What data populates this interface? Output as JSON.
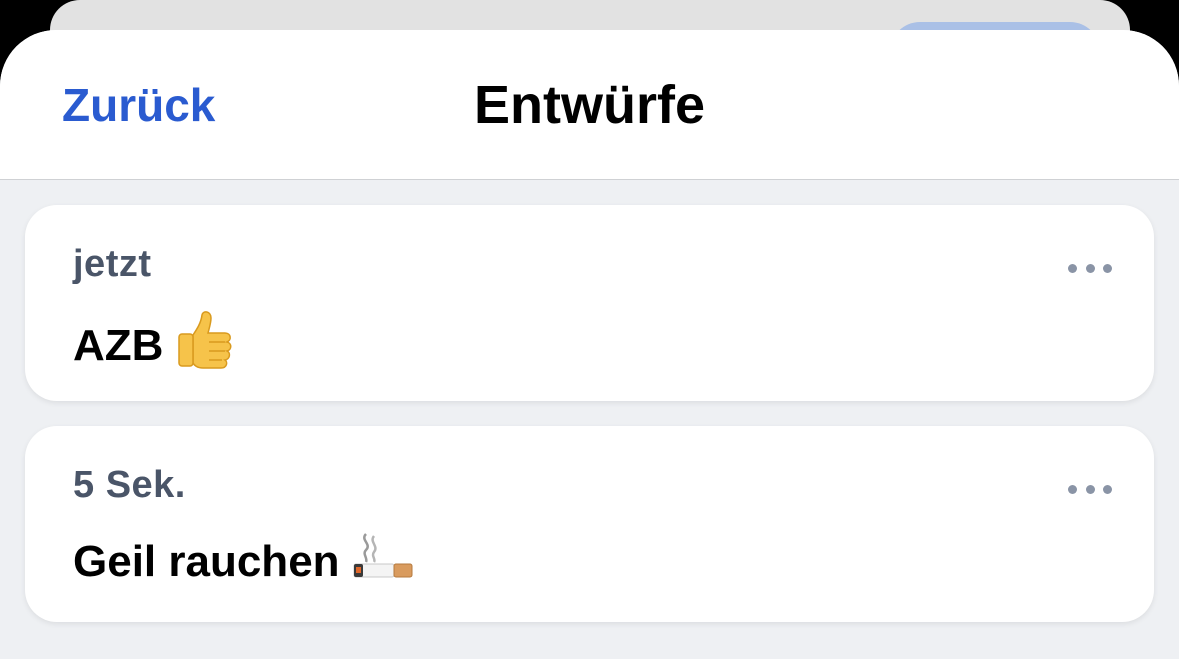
{
  "nav": {
    "back_label": "Zurück",
    "title": "Entwürfe"
  },
  "drafts": [
    {
      "time": "jetzt",
      "text": "AZB",
      "emoji": "thumbs-up"
    },
    {
      "time": "5 Sek.",
      "text": "Geil rauchen",
      "emoji": "cigarette"
    }
  ],
  "colors": {
    "accent": "#2a5bd0",
    "background": "#eef0f3",
    "card": "#ffffff",
    "time_text": "#4a5568",
    "more_dots": "#8a94a6"
  }
}
